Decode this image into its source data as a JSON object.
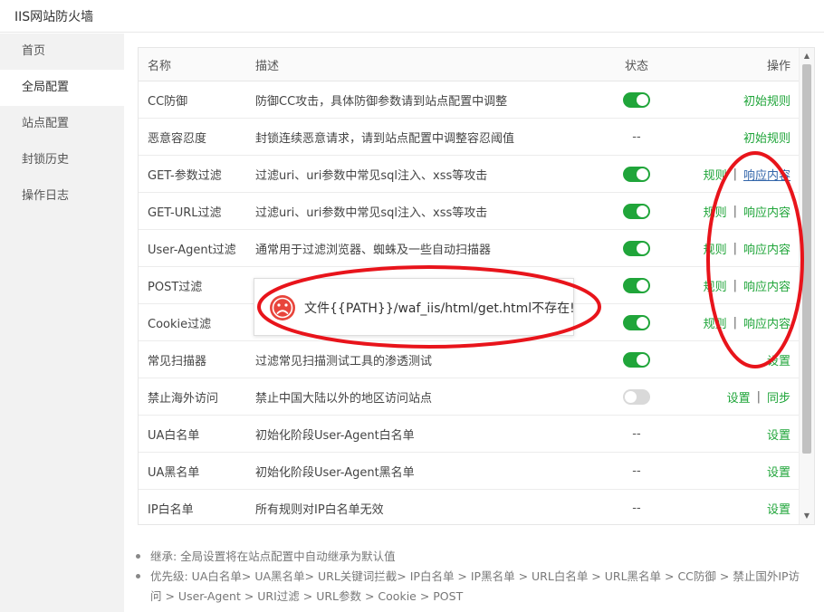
{
  "window": {
    "title": "IIS网站防火墙"
  },
  "sidebar": {
    "items": [
      {
        "label": "首页",
        "active": false
      },
      {
        "label": "全局配置",
        "active": true
      },
      {
        "label": "站点配置",
        "active": false
      },
      {
        "label": "封锁历史",
        "active": false
      },
      {
        "label": "操作日志",
        "active": false
      }
    ]
  },
  "table": {
    "headers": {
      "name": "名称",
      "desc": "描述",
      "status": "状态",
      "ops": "操作"
    },
    "rows": [
      {
        "name": "CC防御",
        "desc": "防御CC攻击，具体防御参数请到站点配置中调整",
        "status": "on",
        "ops": [
          "初始规则"
        ]
      },
      {
        "name": "恶意容忍度",
        "desc": "封锁连续恶意请求，请到站点配置中调整容忍阈值",
        "status": "--",
        "ops": [
          "初始规则"
        ]
      },
      {
        "name": "GET-参数过滤",
        "desc": "过滤uri、uri参数中常见sql注入、xss等攻击",
        "status": "on",
        "ops": [
          "规则",
          "响应内容"
        ]
      },
      {
        "name": "GET-URL过滤",
        "desc": "过滤uri、uri参数中常见sql注入、xss等攻击",
        "status": "on",
        "ops": [
          "规则",
          "响应内容"
        ]
      },
      {
        "name": "User-Agent过滤",
        "desc": "通常用于过滤浏览器、蜘蛛及一些自动扫描器",
        "status": "on",
        "ops": [
          "规则",
          "响应内容"
        ]
      },
      {
        "name": "POST过滤",
        "desc": "",
        "status": "on",
        "ops": [
          "规则",
          "响应内容"
        ]
      },
      {
        "name": "Cookie过滤",
        "desc": "",
        "status": "on",
        "ops": [
          "规则",
          "响应内容"
        ]
      },
      {
        "name": "常见扫描器",
        "desc": "过滤常见扫描测试工具的渗透测试",
        "status": "on",
        "ops": [
          "设置"
        ]
      },
      {
        "name": "禁止海外访问",
        "desc": "禁止中国大陆以外的地区访问站点",
        "status": "off",
        "ops": [
          "设置",
          "同步"
        ]
      },
      {
        "name": "UA白名单",
        "desc": "初始化阶段User-Agent白名单",
        "status": "--",
        "ops": [
          "设置"
        ]
      },
      {
        "name": "UA黑名单",
        "desc": "初始化阶段User-Agent黑名单",
        "status": "--",
        "ops": [
          "设置"
        ]
      },
      {
        "name": "IP白名单",
        "desc": "所有规则对IP白名单无效",
        "status": "--",
        "ops": [
          "设置"
        ]
      }
    ],
    "op_separator": "|",
    "status_dash": "--"
  },
  "scrollbar": {
    "up_glyph": "▲",
    "down_glyph": "▼"
  },
  "popup": {
    "icon": "sad-face-icon",
    "message": "文件{{PATH}}/waf_iis/html/get.html不存在!"
  },
  "notes": [
    "继承: 全局设置将在站点配置中自动继承为默认值",
    "优先级: UA白名单> UA黑名单> URL关键词拦截> IP白名单 > IP黑名单 > URL白名单 > URL黑名单 > CC防御 > 禁止国外IP访问 > User-Agent > URI过滤 > URL参数 > Cookie > POST"
  ],
  "colors": {
    "accent": "#20a53a",
    "annotation": "#e8141b",
    "popup_icon": "#e8453c"
  }
}
